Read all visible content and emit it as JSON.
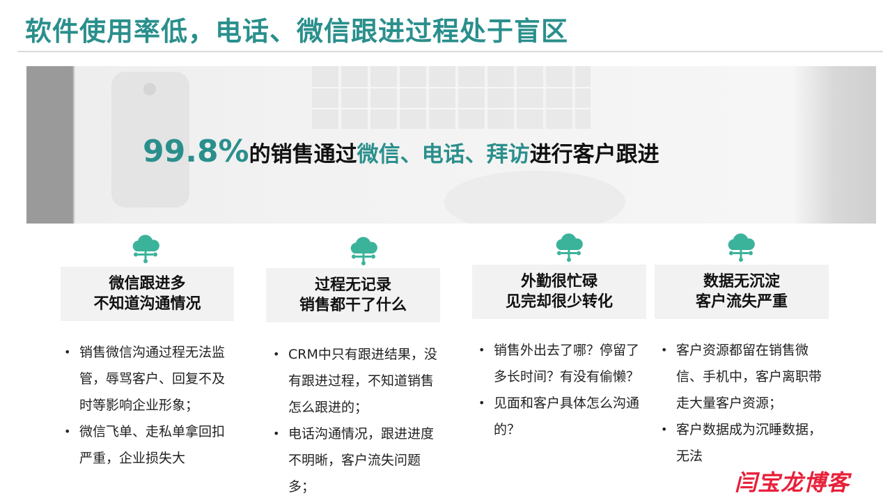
{
  "title": "软件使用率低，电话、微信跟进过程处于盲区",
  "banner": {
    "percent": "99.8%",
    "text_before": "的销售通过",
    "highlight": "微信、电话、拜访",
    "text_after": "进行客户跟进"
  },
  "cards": [
    {
      "icon": "cloud-network-icon",
      "heading_line1": "微信跟进多",
      "heading_line2": "不知道沟通情况",
      "bullets": [
        "销售微信沟通过程无法监管，辱骂客户、回复不及时等影响企业形象；",
        "微信飞单、走私单拿回扣严重，企业损失大"
      ]
    },
    {
      "icon": "cloud-network-icon",
      "heading_line1": "过程无记录",
      "heading_line2": "销售都干了什么",
      "bullets": [
        "CRM中只有跟进结果，没有跟进过程，不知道销售怎么跟进的；",
        "电话沟通情况，跟进进度不明晰，客户流失问题多；"
      ]
    },
    {
      "icon": "cloud-network-icon",
      "heading_line1": "外勤很忙碌",
      "heading_line2": "见完却很少转化",
      "bullets": [
        "销售外出去了哪？停留了多长时间？有没有偷懒？",
        "见面和客户具体怎么沟通的？"
      ]
    },
    {
      "icon": "cloud-network-icon",
      "heading_line1": "数据无沉淀",
      "heading_line2": "客户流失严重",
      "bullets": [
        "客户资源都留在销售微信、手机中，客户离职带走大量客户资源；",
        "客户数据成为沉睡数据，无法"
      ]
    }
  ],
  "watermark": "闫宝龙博客",
  "colors": {
    "accent": "#2a8f8c",
    "icon": "#3bb39b",
    "watermark": "#e8203a"
  }
}
